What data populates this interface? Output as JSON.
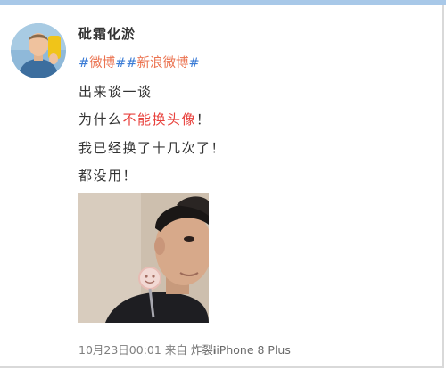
{
  "post": {
    "username": "砒霜化淤",
    "hashtags": [
      {
        "text": "微博"
      },
      {
        "text": "新浪微博"
      }
    ],
    "lines": [
      {
        "parts": [
          "出来谈一谈"
        ]
      },
      {
        "parts": [
          "为什么",
          "不能换头像",
          "！"
        ]
      },
      {
        "parts": [
          "我已经换了十几次了！"
        ]
      },
      {
        "parts": [
          "都没用！"
        ]
      }
    ],
    "timestamp": "10月23日00:01",
    "source_prefix": "来自",
    "source": "炸裂𝐢iPhone 8 Plus"
  },
  "colors": {
    "link": "#3a7bd5",
    "hashtag_text": "#eb7350",
    "highlight": "#e8413c",
    "meta": "#7f7f7f"
  },
  "icons": {
    "avatar": "user-avatar-icon",
    "photo": "attached-photo"
  }
}
